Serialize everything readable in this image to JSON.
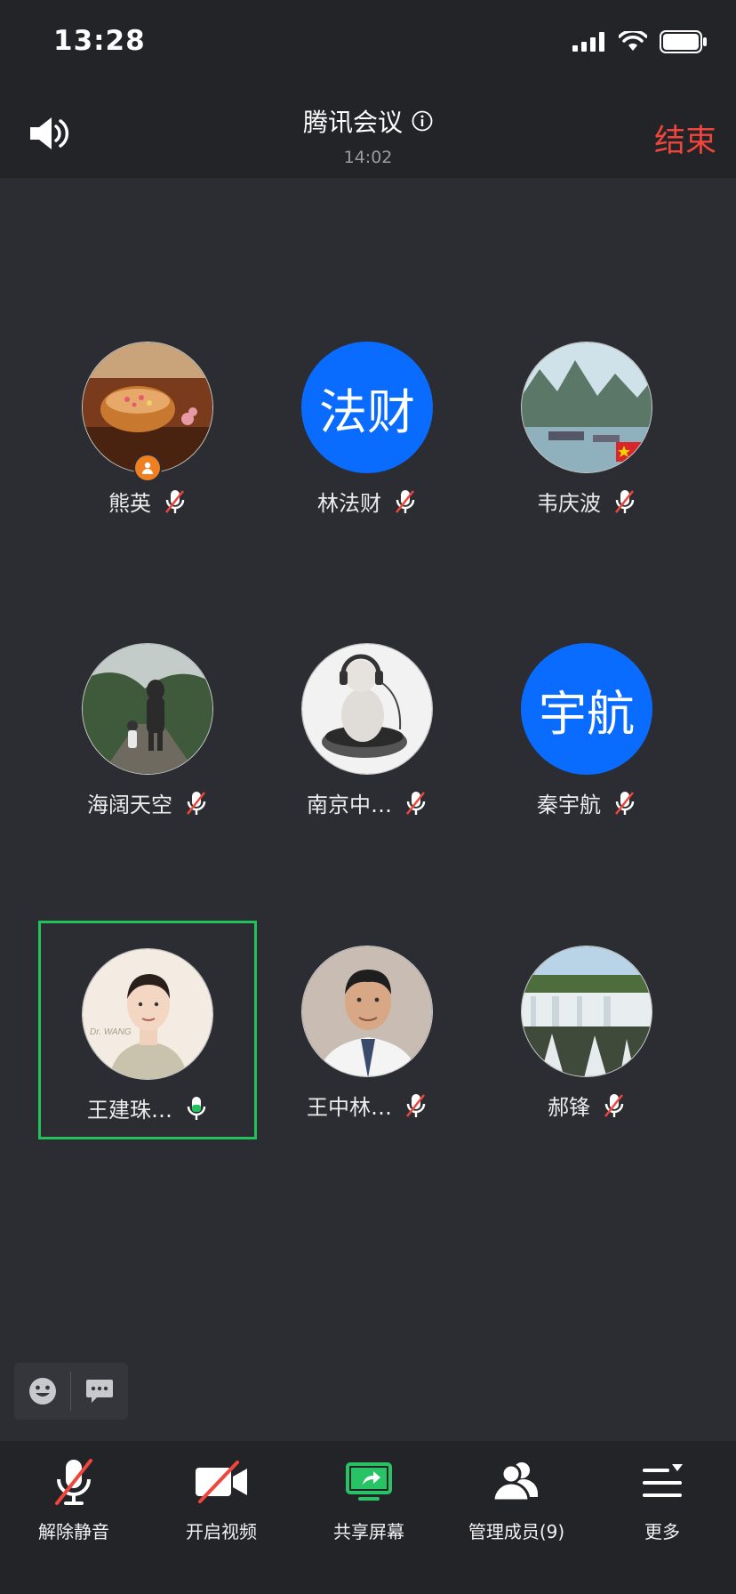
{
  "status_bar": {
    "time": "13:28"
  },
  "header": {
    "title": "腾讯会议",
    "duration": "14:02",
    "end_label": "结束"
  },
  "participants": [
    {
      "name": "熊英",
      "avatar": "photo-tea",
      "muted": true,
      "host": true
    },
    {
      "name": "林法财",
      "avatar_text": "法财",
      "muted": true
    },
    {
      "name": "韦庆波",
      "avatar": "photo-islands",
      "muted": true
    },
    {
      "name": "海阔天空",
      "avatar": "photo-walk",
      "muted": true
    },
    {
      "name": "南京中…",
      "avatar": "photo-baby-headphones",
      "muted": true
    },
    {
      "name": "秦宇航",
      "avatar_text": "宇航",
      "muted": true
    },
    {
      "name": "王建珠…",
      "avatar": "photo-man-portrait",
      "muted": false,
      "speaking": true
    },
    {
      "name": "王中林…",
      "avatar": "photo-doctor",
      "muted": true
    },
    {
      "name": "郝锋",
      "avatar": "photo-waterfall",
      "muted": true
    }
  ],
  "avatar_portrait_caption": "Dr. WANG",
  "toolbar": {
    "unmute": "解除静音",
    "video": "开启视频",
    "share": "共享屏幕",
    "members": "管理成员(9)",
    "more": "更多"
  },
  "colors": {
    "accent_red": "#f0453d",
    "active_green": "#21c25a",
    "avatar_blue": "#0a6cff",
    "host_orange": "#f07f21"
  }
}
